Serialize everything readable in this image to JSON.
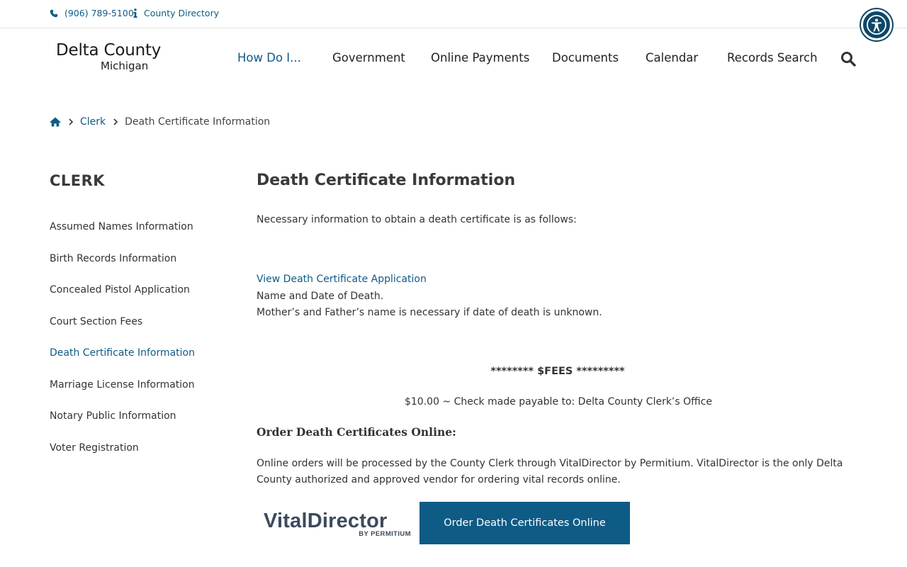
{
  "utility": {
    "phone": "(906) 789-5100",
    "directory": "County Directory",
    "phone_icon": "phone-icon",
    "info_icon": "info-icon"
  },
  "accessibility": {
    "icon": "accessibility-icon",
    "color": "#0d4866"
  },
  "logo": {
    "main": "Delta County",
    "sub": "Michigan"
  },
  "nav": {
    "items": [
      {
        "label": "How Do I..."
      },
      {
        "label": "Government"
      },
      {
        "label": "Online Payments"
      },
      {
        "label": "Documents"
      },
      {
        "label": "Calendar"
      },
      {
        "label": "Records Search"
      }
    ],
    "active_color": "#0e5b85",
    "search_icon": "search-icon"
  },
  "breadcrumb": {
    "home_icon": "home-icon",
    "parent": "Clerk",
    "current": "Death Certificate Information"
  },
  "sidebar": {
    "title": "CLERK",
    "items": [
      {
        "label": "Assumed Names Information"
      },
      {
        "label": "Birth Records Information"
      },
      {
        "label": "Concealed Pistol Application"
      },
      {
        "label": "Court Section Fees"
      },
      {
        "label": "Death Certificate Information"
      },
      {
        "label": "Marriage License Information"
      },
      {
        "label": "Notary Public Information"
      },
      {
        "label": "Voter Registration"
      }
    ]
  },
  "content": {
    "title": "Death Certificate Information",
    "intro": "Necessary information to obtain a death certificate is as follows:",
    "app_link": "View Death Certificate Application",
    "line1": "Name and Date of Death.",
    "line2": "Mother’s and Father’s name is necessary if date of death is unknown.",
    "fees_heading": "******** $FEES *********",
    "fees_detail": "$10.00 ~ Check made payable to: Delta County Clerk’s Office",
    "order_heading": "Order Death Certificates Online:",
    "order_text": "Online orders will be processed by the County Clerk through VitalDirector by Permitium. VitalDirector is the only Delta County authorized and approved vendor for ordering vital records online.",
    "vendor_logo_main": "VitalDirector",
    "vendor_logo_sub": "BY PERMITIUM",
    "order_button": "Order Death Certificates Online"
  },
  "colors": {
    "link": "#0e5b85",
    "button": "#0e5b85",
    "text": "#333333"
  }
}
